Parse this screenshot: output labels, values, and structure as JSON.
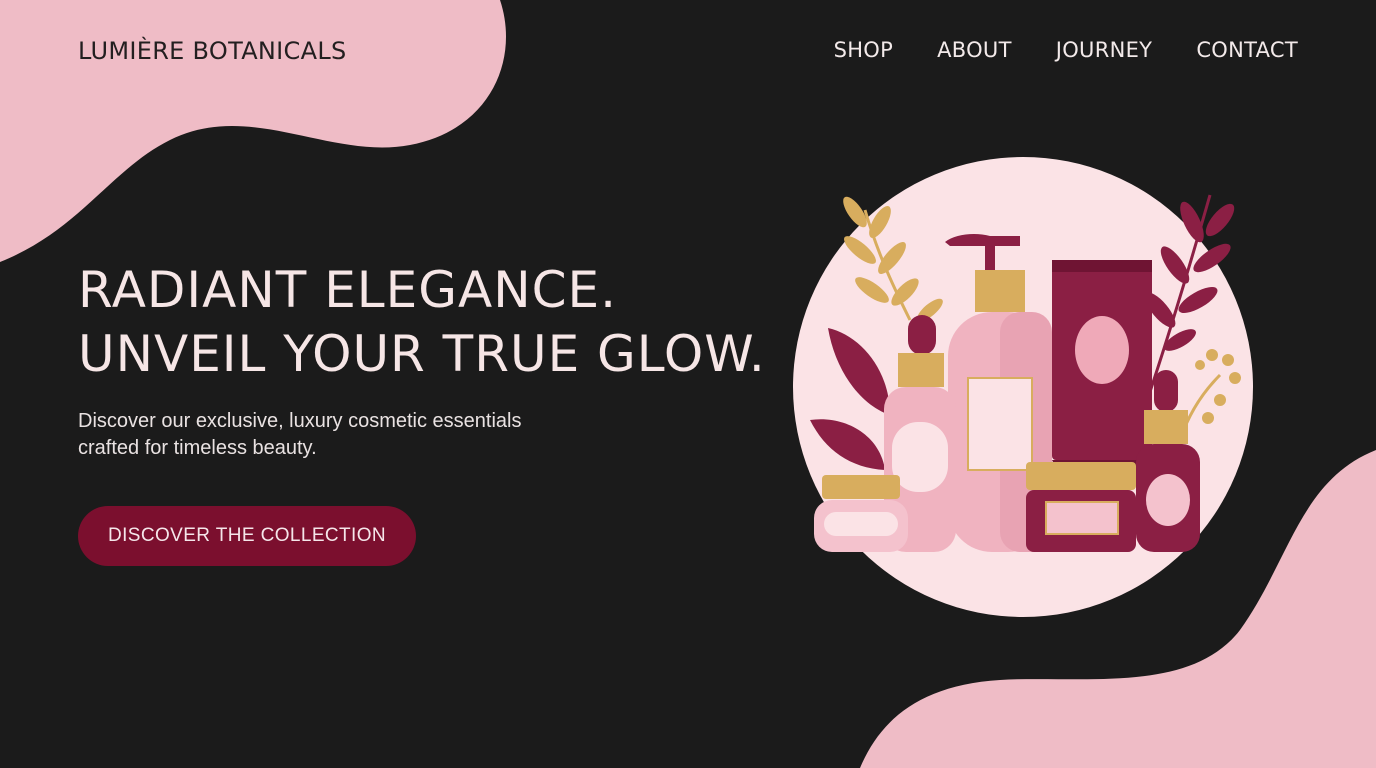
{
  "brand": {
    "name": "LUMIÈRE BOTANICALS"
  },
  "nav": {
    "items": [
      "SHOP",
      "ABOUT",
      "JOURNEY",
      "CONTACT"
    ]
  },
  "hero": {
    "headline": [
      "RADIANT ELEGANCE.",
      "UNVEIL YOUR TRUE GLOW."
    ],
    "subtext": [
      "Discover our exclusive, luxury cosmetic essentials",
      "crafted for timeless beauty."
    ],
    "cta_label": "DISCOVER THE COLLECTION"
  },
  "colors": {
    "background": "#1b1b1b",
    "blob_pink": "#efbcc6",
    "circle_pink": "#fbe3e6",
    "accent_burgundy": "#7b0f2e",
    "gold": "#d8ad5e"
  },
  "illustration": {
    "icons": [
      "dropper-bottle-icon",
      "pump-bottle-icon",
      "tube-icon",
      "jar-icon",
      "leaf-icon"
    ]
  }
}
